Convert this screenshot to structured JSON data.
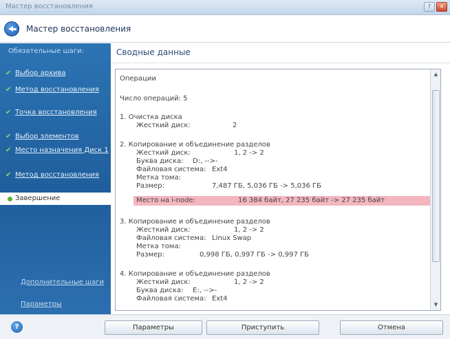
{
  "window": {
    "title": "Мастер восстановления"
  },
  "header": {
    "title": "Мастер восстановления"
  },
  "sidebar": {
    "steps_title": "Обязательные шаги:",
    "steps": [
      {
        "label": "Выбор архива"
      },
      {
        "label": "Метод восстановления"
      },
      {
        "label": "Точка восстановления"
      },
      {
        "label": "Выбор элементов"
      },
      {
        "label": "Место назначения Диск 1"
      },
      {
        "label": "Метод восстановления"
      }
    ],
    "current_step": "Завершение",
    "optional_steps": "Дополнительные шаги",
    "options_link": "Параметры"
  },
  "main": {
    "title": "Сводные данные",
    "operations": {
      "heading": "Операции",
      "count_line": "Число операций: 5",
      "op1": {
        "title": "1. Очистка диска",
        "hdd_label": "Жесткий диск:",
        "hdd_value": "2"
      },
      "op2": {
        "title": "2. Копирование и объединение разделов",
        "hdd_label": "Жесткий диск:",
        "hdd_value": "1, 2 -> 2",
        "letter_label": "Буква диска:",
        "letter_value": "D:, -->-",
        "fs_label": "Файловая система:",
        "fs_value": "Ext4",
        "vol_label": "Метка тома:",
        "size_label": "Размер:",
        "size_value": "7,487 ГБ, 5,036 ГБ -> 5,036 ГБ",
        "free_label": "Место на i-node:",
        "free_value": "16 384 байт, 27 235 байт -> 27 235 байт"
      },
      "op3": {
        "title": "3. Копирование и объединение разделов",
        "hdd_label": "Жесткий диск:",
        "hdd_value": "1, 2 -> 2",
        "fs_label": "Файловая система:",
        "fs_value": "Linux Swap",
        "vol_label": "Метка тома:",
        "size_label": "Размер:",
        "size_value": "0,998 ГБ, 0,997 ГБ -> 0,997 ГБ"
      },
      "op4": {
        "title": "4. Копирование и объединение разделов",
        "hdd_label": "Жесткий диск:",
        "hdd_value": "1, 2 -> 2",
        "letter_label": "Буква диска:",
        "letter_value": "E:, -->-",
        "fs_label": "Файловая система:",
        "fs_value": "Ext4"
      }
    }
  },
  "buttons": {
    "options": "Параметры",
    "proceed": "Приступить",
    "cancel": "Отмена"
  },
  "colors": {
    "sidebar": "#2369a8",
    "highlight": "#f3b6bf",
    "accent": "#1d58b0"
  }
}
